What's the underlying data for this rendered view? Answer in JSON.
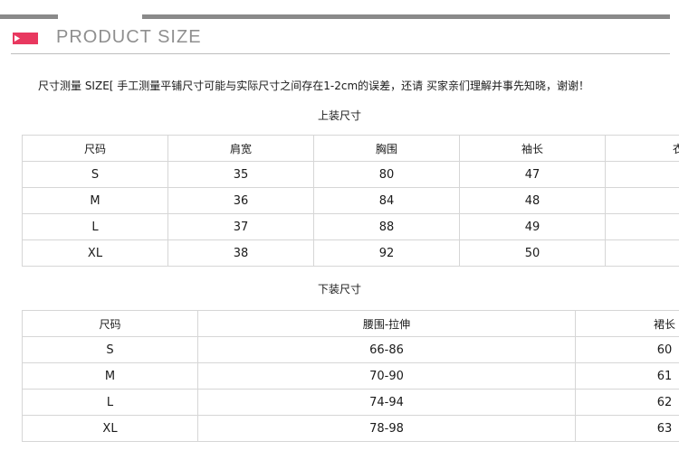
{
  "header": {
    "title": "PRODUCT SIZE",
    "icon": "pink-flag-icon",
    "accent_color": "#e8385f"
  },
  "notice": "尺寸测量 SIZE[ 手工测量平铺尺寸可能与实际尺寸之间存在1-2cm的误差，还请 买家亲们理解并事先知晓，谢谢！",
  "top_table": {
    "caption": "上装尺寸",
    "headers": [
      "尺码",
      "肩宽",
      "胸围",
      "袖长",
      "衣"
    ],
    "rows": [
      [
        "S",
        "35",
        "80",
        "47",
        ""
      ],
      [
        "M",
        "36",
        "84",
        "48",
        ""
      ],
      [
        "L",
        "37",
        "88",
        "49",
        ""
      ],
      [
        "XL",
        "38",
        "92",
        "50",
        ""
      ]
    ]
  },
  "bottom_table": {
    "caption": "下装尺寸",
    "headers": [
      "尺码",
      "腰围-拉伸",
      "裙长"
    ],
    "rows": [
      [
        "S",
        "66-86",
        "60"
      ],
      [
        "M",
        "70-90",
        "61"
      ],
      [
        "L",
        "74-94",
        "62"
      ],
      [
        "XL",
        "78-98",
        "63"
      ]
    ]
  }
}
